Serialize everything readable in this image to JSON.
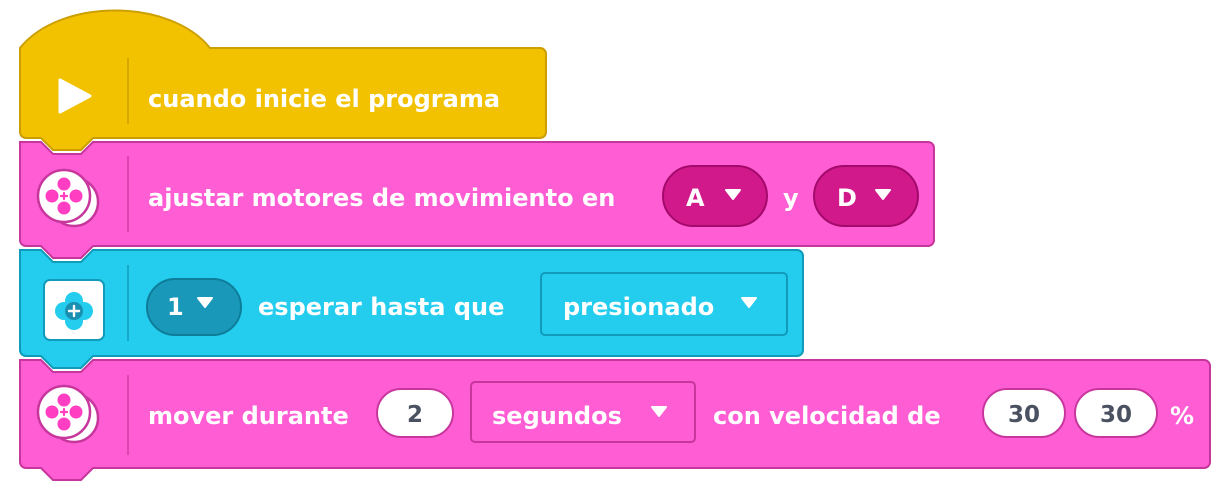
{
  "colors": {
    "event_yellow": "#F2C200",
    "event_yellow_stroke": "#CC9F00",
    "motor_pink": "#FF5DD3",
    "motor_pink_stroke": "#C7369C",
    "dropdown_magenta": "#D1198C",
    "dropdown_magenta_stroke": "#A30A6B",
    "hub_cyan": "#24CCEE",
    "hub_cyan_stroke": "#109BBA",
    "hub_dropdown": "#1A98BA",
    "text_white": "#FFFFFF",
    "value_text": "#4A5160"
  },
  "blocks": {
    "hat": {
      "icon": "play-icon",
      "label": "cuando inicie el programa"
    },
    "set_motors": {
      "icon": "motor-pair-icon",
      "label": "ajustar motores de movimiento en",
      "port_left": "A",
      "connector": "y",
      "port_right": "D"
    },
    "wait": {
      "icon": "hub-button-icon",
      "button_value": "1",
      "label": "esperar hasta que",
      "state_value": "presionado"
    },
    "move": {
      "icon": "motor-pair-icon",
      "label": "mover durante",
      "amount": "2",
      "unit": "segundos",
      "speed_label": "con velocidad de",
      "speed_left": "30",
      "speed_right": "30",
      "percent": "%"
    }
  }
}
